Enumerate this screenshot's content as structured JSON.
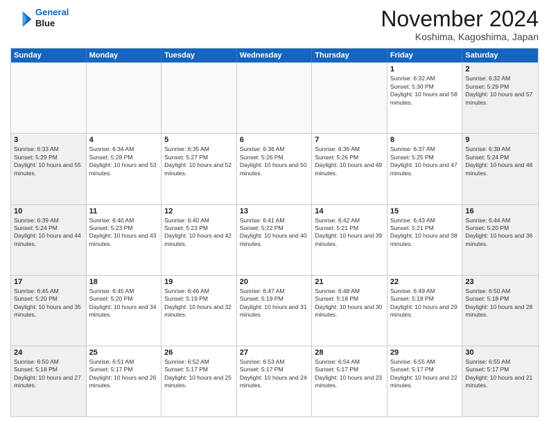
{
  "header": {
    "logo_line1": "General",
    "logo_line2": "Blue",
    "month": "November 2024",
    "location": "Koshima, Kagoshima, Japan"
  },
  "days_of_week": [
    "Sunday",
    "Monday",
    "Tuesday",
    "Wednesday",
    "Thursday",
    "Friday",
    "Saturday"
  ],
  "weeks": [
    [
      {
        "day": "",
        "info": "",
        "empty": true
      },
      {
        "day": "",
        "info": "",
        "empty": true
      },
      {
        "day": "",
        "info": "",
        "empty": true
      },
      {
        "day": "",
        "info": "",
        "empty": true
      },
      {
        "day": "",
        "info": "",
        "empty": true
      },
      {
        "day": "1",
        "info": "Sunrise: 6:32 AM\nSunset: 5:30 PM\nDaylight: 10 hours and 58 minutes.",
        "empty": false
      },
      {
        "day": "2",
        "info": "Sunrise: 6:32 AM\nSunset: 5:29 PM\nDaylight: 10 hours and 57 minutes.",
        "empty": false
      }
    ],
    [
      {
        "day": "3",
        "info": "Sunrise: 6:33 AM\nSunset: 5:29 PM\nDaylight: 10 hours and 55 minutes.",
        "empty": false
      },
      {
        "day": "4",
        "info": "Sunrise: 6:34 AM\nSunset: 5:28 PM\nDaylight: 10 hours and 53 minutes.",
        "empty": false
      },
      {
        "day": "5",
        "info": "Sunrise: 6:35 AM\nSunset: 5:27 PM\nDaylight: 10 hours and 52 minutes.",
        "empty": false
      },
      {
        "day": "6",
        "info": "Sunrise: 6:36 AM\nSunset: 5:26 PM\nDaylight: 10 hours and 50 minutes.",
        "empty": false
      },
      {
        "day": "7",
        "info": "Sunrise: 6:36 AM\nSunset: 5:26 PM\nDaylight: 10 hours and 49 minutes.",
        "empty": false
      },
      {
        "day": "8",
        "info": "Sunrise: 6:37 AM\nSunset: 5:25 PM\nDaylight: 10 hours and 47 minutes.",
        "empty": false
      },
      {
        "day": "9",
        "info": "Sunrise: 6:38 AM\nSunset: 5:24 PM\nDaylight: 10 hours and 46 minutes.",
        "empty": false
      }
    ],
    [
      {
        "day": "10",
        "info": "Sunrise: 6:39 AM\nSunset: 5:24 PM\nDaylight: 10 hours and 44 minutes.",
        "empty": false
      },
      {
        "day": "11",
        "info": "Sunrise: 6:40 AM\nSunset: 5:23 PM\nDaylight: 10 hours and 43 minutes.",
        "empty": false
      },
      {
        "day": "12",
        "info": "Sunrise: 6:40 AM\nSunset: 5:23 PM\nDaylight: 10 hours and 42 minutes.",
        "empty": false
      },
      {
        "day": "13",
        "info": "Sunrise: 6:41 AM\nSunset: 5:22 PM\nDaylight: 10 hours and 40 minutes.",
        "empty": false
      },
      {
        "day": "14",
        "info": "Sunrise: 6:42 AM\nSunset: 5:21 PM\nDaylight: 10 hours and 39 minutes.",
        "empty": false
      },
      {
        "day": "15",
        "info": "Sunrise: 6:43 AM\nSunset: 5:21 PM\nDaylight: 10 hours and 38 minutes.",
        "empty": false
      },
      {
        "day": "16",
        "info": "Sunrise: 6:44 AM\nSunset: 5:20 PM\nDaylight: 10 hours and 36 minutes.",
        "empty": false
      }
    ],
    [
      {
        "day": "17",
        "info": "Sunrise: 6:45 AM\nSunset: 5:20 PM\nDaylight: 10 hours and 35 minutes.",
        "empty": false
      },
      {
        "day": "18",
        "info": "Sunrise: 6:45 AM\nSunset: 5:20 PM\nDaylight: 10 hours and 34 minutes.",
        "empty": false
      },
      {
        "day": "19",
        "info": "Sunrise: 6:46 AM\nSunset: 5:19 PM\nDaylight: 10 hours and 32 minutes.",
        "empty": false
      },
      {
        "day": "20",
        "info": "Sunrise: 6:47 AM\nSunset: 5:19 PM\nDaylight: 10 hours and 31 minutes.",
        "empty": false
      },
      {
        "day": "21",
        "info": "Sunrise: 6:48 AM\nSunset: 5:18 PM\nDaylight: 10 hours and 30 minutes.",
        "empty": false
      },
      {
        "day": "22",
        "info": "Sunrise: 6:49 AM\nSunset: 5:18 PM\nDaylight: 10 hours and 29 minutes.",
        "empty": false
      },
      {
        "day": "23",
        "info": "Sunrise: 6:50 AM\nSunset: 5:18 PM\nDaylight: 10 hours and 28 minutes.",
        "empty": false
      }
    ],
    [
      {
        "day": "24",
        "info": "Sunrise: 6:50 AM\nSunset: 5:18 PM\nDaylight: 10 hours and 27 minutes.",
        "empty": false
      },
      {
        "day": "25",
        "info": "Sunrise: 6:51 AM\nSunset: 5:17 PM\nDaylight: 10 hours and 26 minutes.",
        "empty": false
      },
      {
        "day": "26",
        "info": "Sunrise: 6:52 AM\nSunset: 5:17 PM\nDaylight: 10 hours and 25 minutes.",
        "empty": false
      },
      {
        "day": "27",
        "info": "Sunrise: 6:53 AM\nSunset: 5:17 PM\nDaylight: 10 hours and 24 minutes.",
        "empty": false
      },
      {
        "day": "28",
        "info": "Sunrise: 6:54 AM\nSunset: 5:17 PM\nDaylight: 10 hours and 23 minutes.",
        "empty": false
      },
      {
        "day": "29",
        "info": "Sunrise: 6:55 AM\nSunset: 5:17 PM\nDaylight: 10 hours and 22 minutes.",
        "empty": false
      },
      {
        "day": "30",
        "info": "Sunrise: 6:55 AM\nSunset: 5:17 PM\nDaylight: 10 hours and 21 minutes.",
        "empty": false
      }
    ]
  ]
}
